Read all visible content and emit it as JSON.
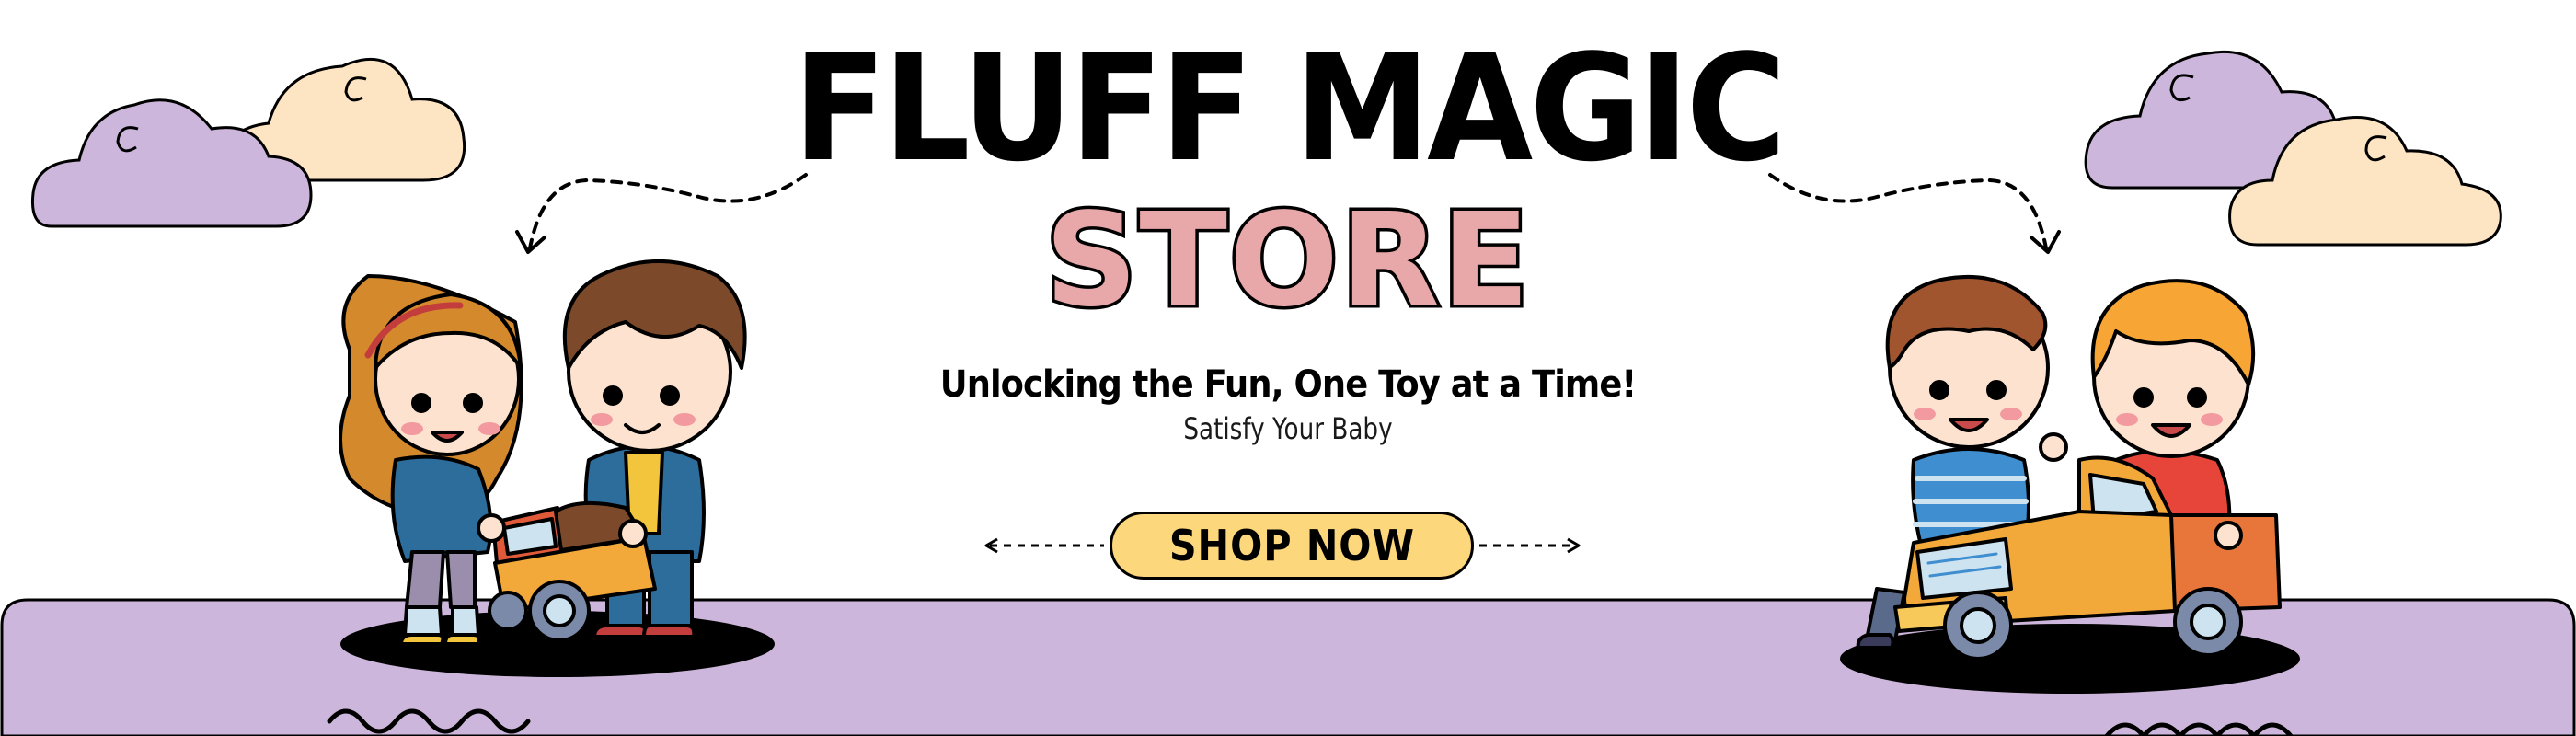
{
  "banner": {
    "title": "FLUFF MAGIC",
    "subtitle": "STORE",
    "tagline": "Unlocking the Fun, One Toy at a Time!",
    "subtagline": "Satisfy Your Baby",
    "cta_label": "SHOP NOW"
  },
  "colors": {
    "lavender": "#cdb6db",
    "cream": "#fde5c3",
    "pink": "#e8a7a8",
    "button": "#fdd77c",
    "ink": "#000000"
  },
  "icons": [
    "cloud-icon",
    "dashed-arrow-icon",
    "squiggle-icon",
    "kids-illustration"
  ]
}
